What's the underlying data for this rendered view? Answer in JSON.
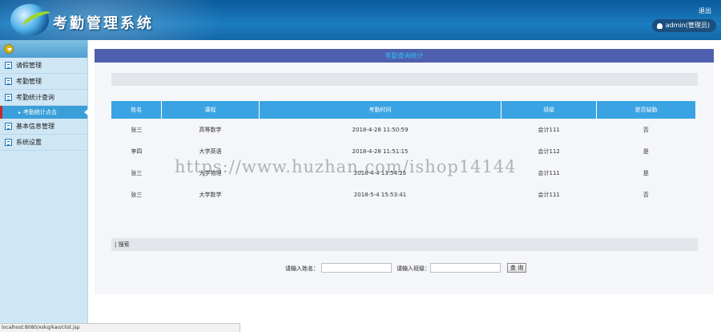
{
  "header": {
    "app_title": "考勤管理系统",
    "logout_label": "退出",
    "user_label": "admin(管理员)"
  },
  "sidebar": {
    "items": [
      {
        "label": "请假管理"
      },
      {
        "label": "考勤管理"
      },
      {
        "label": "考勤统计查询"
      },
      {
        "label": "考勤统计点击"
      },
      {
        "label": "基本信息管理"
      },
      {
        "label": "系统设置"
      }
    ]
  },
  "main": {
    "panel_title": "考勤查询统计",
    "table": {
      "headers": [
        "姓名",
        "课程",
        "考勤时间",
        "班级",
        "是否缺勤"
      ],
      "rows": [
        [
          "张三",
          "高等数学",
          "2018-4-28 11:50:59",
          "会计111",
          "否"
        ],
        [
          "李四",
          "大学英语",
          "2018-4-28 11:51:15",
          "会计112",
          "是"
        ],
        [
          "张三",
          "大学物理",
          "2018-4-4 13:54:25",
          "会计111",
          "是"
        ],
        [
          "张三",
          "大学数学",
          "2018-5-4 15:53:41",
          "会计111",
          "否"
        ]
      ]
    },
    "search": {
      "section_label": "| 搜索",
      "name_label": "请输入姓名：",
      "class_label": "请输入班级：",
      "name_value": "",
      "class_value": "",
      "button_label": "查 询"
    }
  },
  "status_bar": {
    "url": "localhost:8080/xskq/kao/clist.jsp"
  },
  "watermark": "https://www.huzhan.com/ishop14144"
}
